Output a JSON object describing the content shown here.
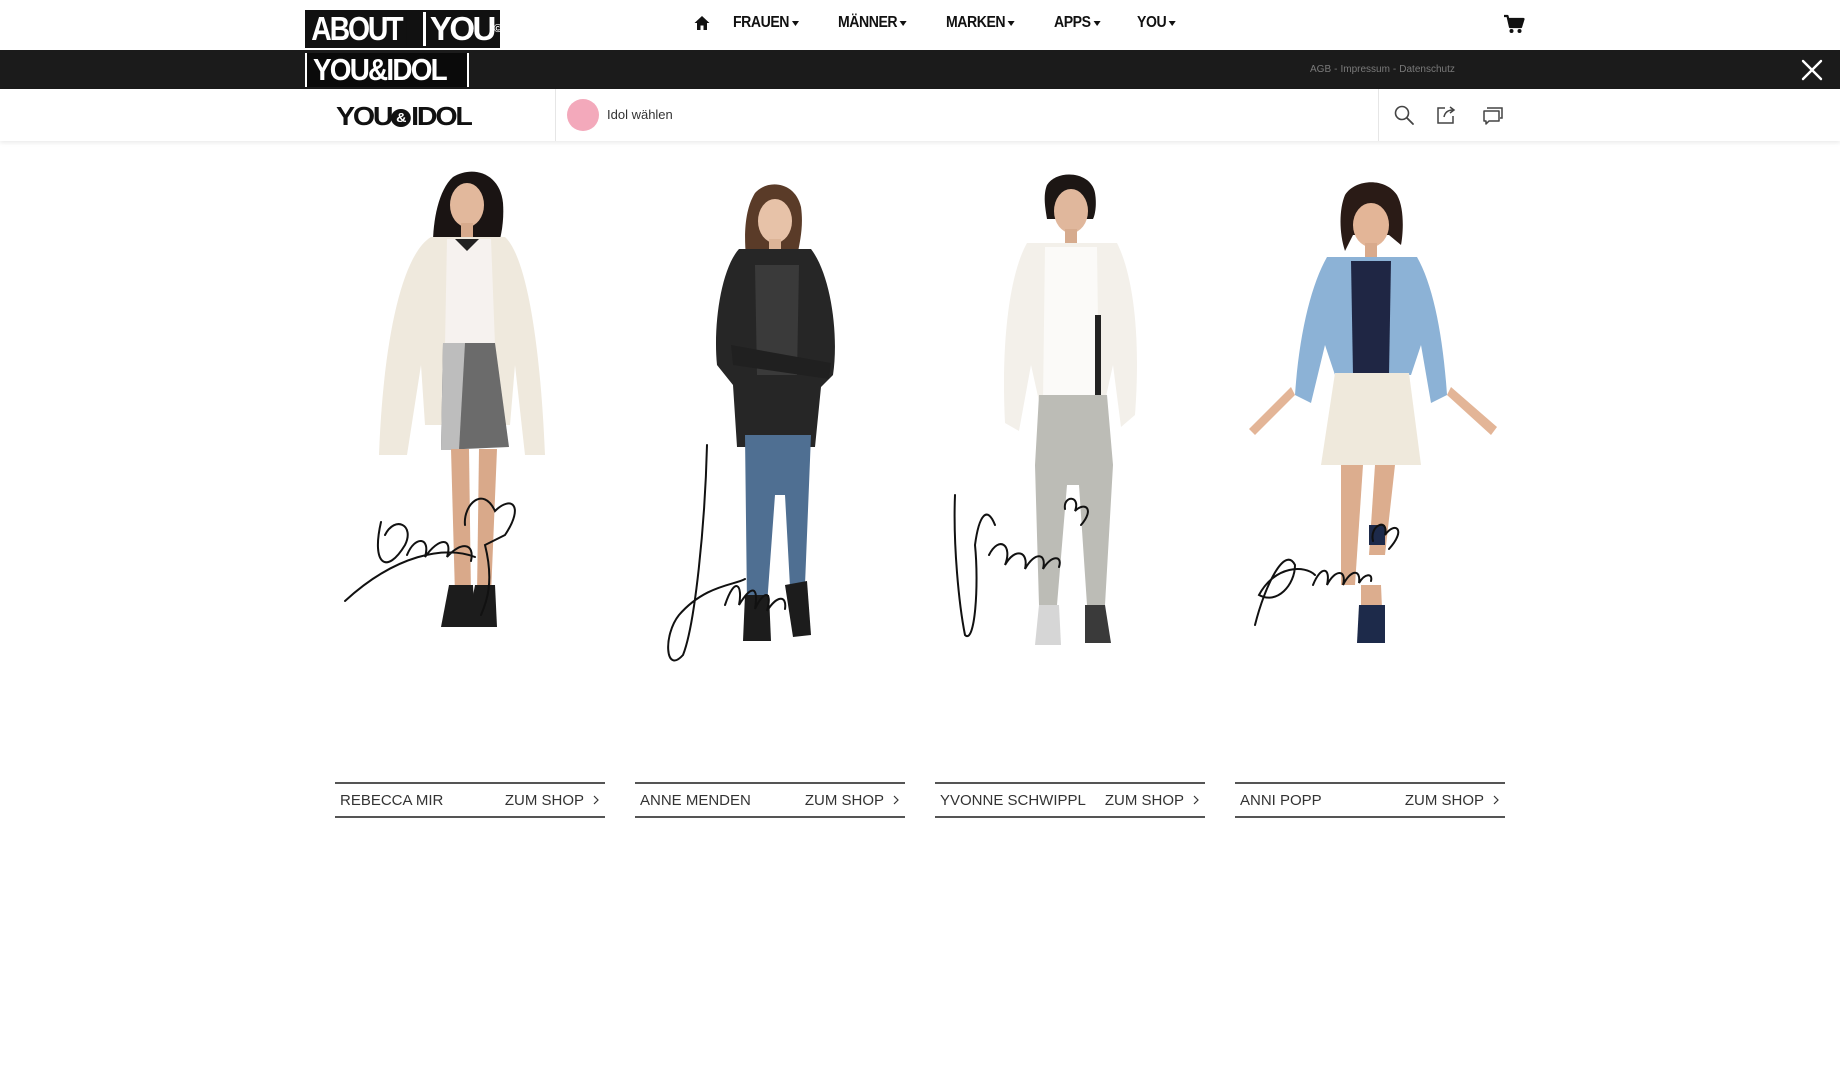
{
  "colors": {
    "black_bar": "#1b1b1b",
    "idol_dot": "#f3a9bb",
    "text": "#333333"
  },
  "topnav": {
    "logo_part1": "ABOUT",
    "logo_part2": "YOU",
    "logo_reg": "©",
    "home_icon": "home-icon",
    "items": [
      {
        "label": "FRAUEN"
      },
      {
        "label": "MÄNNER"
      },
      {
        "label": "MARKEN"
      },
      {
        "label": "APPS"
      },
      {
        "label": "YOU"
      }
    ],
    "cart_icon": "cart-icon"
  },
  "blackbar": {
    "title": "YOU&IDOL",
    "legal": [
      "AGB",
      "Impressum",
      "Datenschutz"
    ],
    "separator": "-",
    "close_icon": "close-icon"
  },
  "subheader": {
    "logo_left": "YOU",
    "logo_amp": "&",
    "logo_right": "IDOL",
    "idol_select_label": "Idol wählen",
    "icons": [
      "search-icon",
      "share-icon",
      "chat-icon"
    ]
  },
  "idols": [
    {
      "name": "REBECCA MIR",
      "shop_label": "ZUM SHOP",
      "signature": "Becca"
    },
    {
      "name": "ANNE MENDEN",
      "shop_label": "ZUM SHOP",
      "signature": "Anne"
    },
    {
      "name": "YVONNE SCHWIPPL",
      "shop_label": "ZUM SHOP",
      "signature": "Yvonne"
    },
    {
      "name": "ANNI POPP",
      "shop_label": "ZUM SHOP",
      "signature": "Anni"
    }
  ]
}
